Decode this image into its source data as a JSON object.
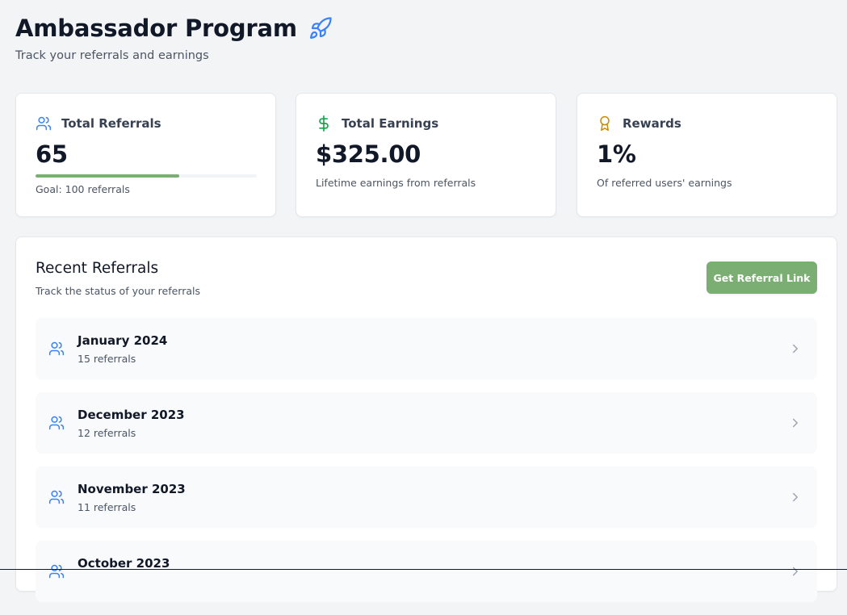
{
  "header": {
    "title": "Ambassador Program",
    "subtitle": "Track your referrals and earnings",
    "title_icon": "rocket-icon"
  },
  "stats": {
    "referrals": {
      "label": "Total Referrals",
      "value": "65",
      "goal_text": "Goal: 100 referrals",
      "progress_fraction": 0.65,
      "icon": "users-icon"
    },
    "earnings": {
      "label": "Total Earnings",
      "value": "$325.00",
      "subtext": "Lifetime earnings from referrals",
      "icon": "dollar-sign-icon"
    },
    "rewards": {
      "label": "Rewards",
      "value": "1%",
      "subtext": "Of referred users' earnings",
      "icon": "award-icon"
    }
  },
  "recent": {
    "title": "Recent Referrals",
    "subtitle": "Track the status of your referrals",
    "button_label": "Get Referral Link",
    "items": [
      {
        "month": "January 2024",
        "count": "15 referrals"
      },
      {
        "month": "December 2023",
        "count": "12 referrals"
      },
      {
        "month": "November 2023",
        "count": "11 referrals"
      },
      {
        "month": "October 2023",
        "count": ""
      }
    ]
  },
  "colors": {
    "accent_green": "#7bae72",
    "icon_blue": "#3b82f6",
    "dollar_green": "#16a34a",
    "award_gold": "#ca8a04",
    "background": "#f3f4f6"
  }
}
